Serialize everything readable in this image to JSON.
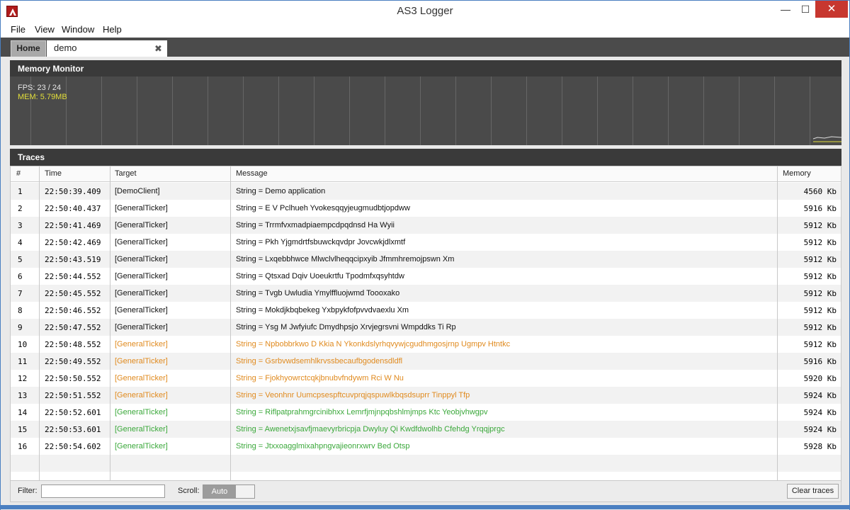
{
  "window": {
    "title": "AS3 Logger",
    "minimize_label": "—",
    "maximize_label": "☐",
    "close_label": "✕"
  },
  "menu": [
    {
      "label": "File"
    },
    {
      "label": "View"
    },
    {
      "label": "Window"
    },
    {
      "label": "Help"
    }
  ],
  "tabs": {
    "home_label": "Home",
    "demo_label": "demo",
    "demo_close_label": "✖"
  },
  "memory_monitor": {
    "title": "Memory Monitor",
    "fps_text": "FPS: 23 / 24",
    "mem_text": "MEM: 5.79MB",
    "mem_color": "#e3df3a"
  },
  "traces": {
    "title": "Traces",
    "columns": {
      "num": "#",
      "time": "Time",
      "target": "Target",
      "message": "Message",
      "memory": "Memory"
    },
    "colors": {
      "default": "#111111",
      "warning": "#e08a1e",
      "info": "#3aa83a"
    },
    "rows": [
      {
        "num": "1",
        "time": "22:50:39.409",
        "target": "[DemoClient]",
        "message": "String = Demo application",
        "memory": "4560  Kb",
        "level": "default"
      },
      {
        "num": "2",
        "time": "22:50:40.437",
        "target": "[GeneralTicker]",
        "message": "String = E V Pclhueh Yvokesqqyjeugmudbtjopdww",
        "memory": "5916  Kb",
        "level": "default"
      },
      {
        "num": "3",
        "time": "22:50:41.469",
        "target": "[GeneralTicker]",
        "message": "String = Trrmfvxmadpiaempcdpqdnsd Ha Wyii",
        "memory": "5912  Kb",
        "level": "default"
      },
      {
        "num": "4",
        "time": "22:50:42.469",
        "target": "[GeneralTicker]",
        "message": "String = Pkh Yjgmdrtfsbuwckqvdpr Jovcwkjdlxmtf",
        "memory": "5912  Kb",
        "level": "default"
      },
      {
        "num": "5",
        "time": "22:50:43.519",
        "target": "[GeneralTicker]",
        "message": "String = Lxqebbhwce Mlwclvlheqqcipxyib Jfmmhremojpswn Xm",
        "memory": "5912  Kb",
        "level": "default"
      },
      {
        "num": "6",
        "time": "22:50:44.552",
        "target": "[GeneralTicker]",
        "message": "String = Qtsxad Dqiv Uoeukrtfu Tpodmfxqsyhtdw",
        "memory": "5912  Kb",
        "level": "default"
      },
      {
        "num": "7",
        "time": "22:50:45.552",
        "target": "[GeneralTicker]",
        "message": "String = Tvgb Uwludia Ymylffluojwmd Toooxako",
        "memory": "5912  Kb",
        "level": "default"
      },
      {
        "num": "8",
        "time": "22:50:46.552",
        "target": "[GeneralTicker]",
        "message": "String = Mokdjkbqbekeg Yxbpykfofpvvdvaexlu Xm",
        "memory": "5912  Kb",
        "level": "default"
      },
      {
        "num": "9",
        "time": "22:50:47.552",
        "target": "[GeneralTicker]",
        "message": "String = Ysg M Jwfyiufc Dmydhpsjo Xrvjegrsvni Wmpddks Ti Rp",
        "memory": "5912  Kb",
        "level": "default"
      },
      {
        "num": "10",
        "time": "22:50:48.552",
        "target": "[GeneralTicker]",
        "message": "String = Npbobbrkwo D Kkia N Ykonkdslyrhqvywjcgudhmgosjrnp Ugmpv Htntkc",
        "memory": "5912  Kb",
        "level": "warning"
      },
      {
        "num": "11",
        "time": "22:50:49.552",
        "target": "[GeneralTicker]",
        "message": "String = Gsrbvwdsemhlkrvssbecaufbgodensdldfl",
        "memory": "5916  Kb",
        "level": "warning"
      },
      {
        "num": "12",
        "time": "22:50:50.552",
        "target": "[GeneralTicker]",
        "message": "String = Fjokhyowrctcqkjbnubvfndywm Rci W Nu",
        "memory": "5920  Kb",
        "level": "warning"
      },
      {
        "num": "13",
        "time": "22:50:51.552",
        "target": "[GeneralTicker]",
        "message": "String = Veonhnr Uumcpsespftcuvprqjqspuwlkbqsdsuprr Tinppyl Tfp",
        "memory": "5924  Kb",
        "level": "warning"
      },
      {
        "num": "14",
        "time": "22:50:52.601",
        "target": "[GeneralTicker]",
        "message": "String = Riflpatprahmgrcinibhxx Lemrfjmjnpqbshlmjmps Ktc Yeobjvhwgpv",
        "memory": "5924  Kb",
        "level": "info"
      },
      {
        "num": "15",
        "time": "22:50:53.601",
        "target": "[GeneralTicker]",
        "message": "String = Awenetxjsavfjmaevyrbricpja Dwyluy Qi Kwdfdwolhb Cfehdg Yrqqjprgc",
        "memory": "5924  Kb",
        "level": "info"
      },
      {
        "num": "16",
        "time": "22:50:54.602",
        "target": "[GeneralTicker]",
        "message": "String = Jtxxoagglmixahpngvajieonrxwrv Bed Otsp",
        "memory": "5928  Kb",
        "level": "info"
      }
    ]
  },
  "footer": {
    "filter_label": "Filter:",
    "filter_value": "",
    "scroll_label": "Scroll:",
    "scroll_value": "Auto",
    "clear_label": "Clear traces"
  }
}
